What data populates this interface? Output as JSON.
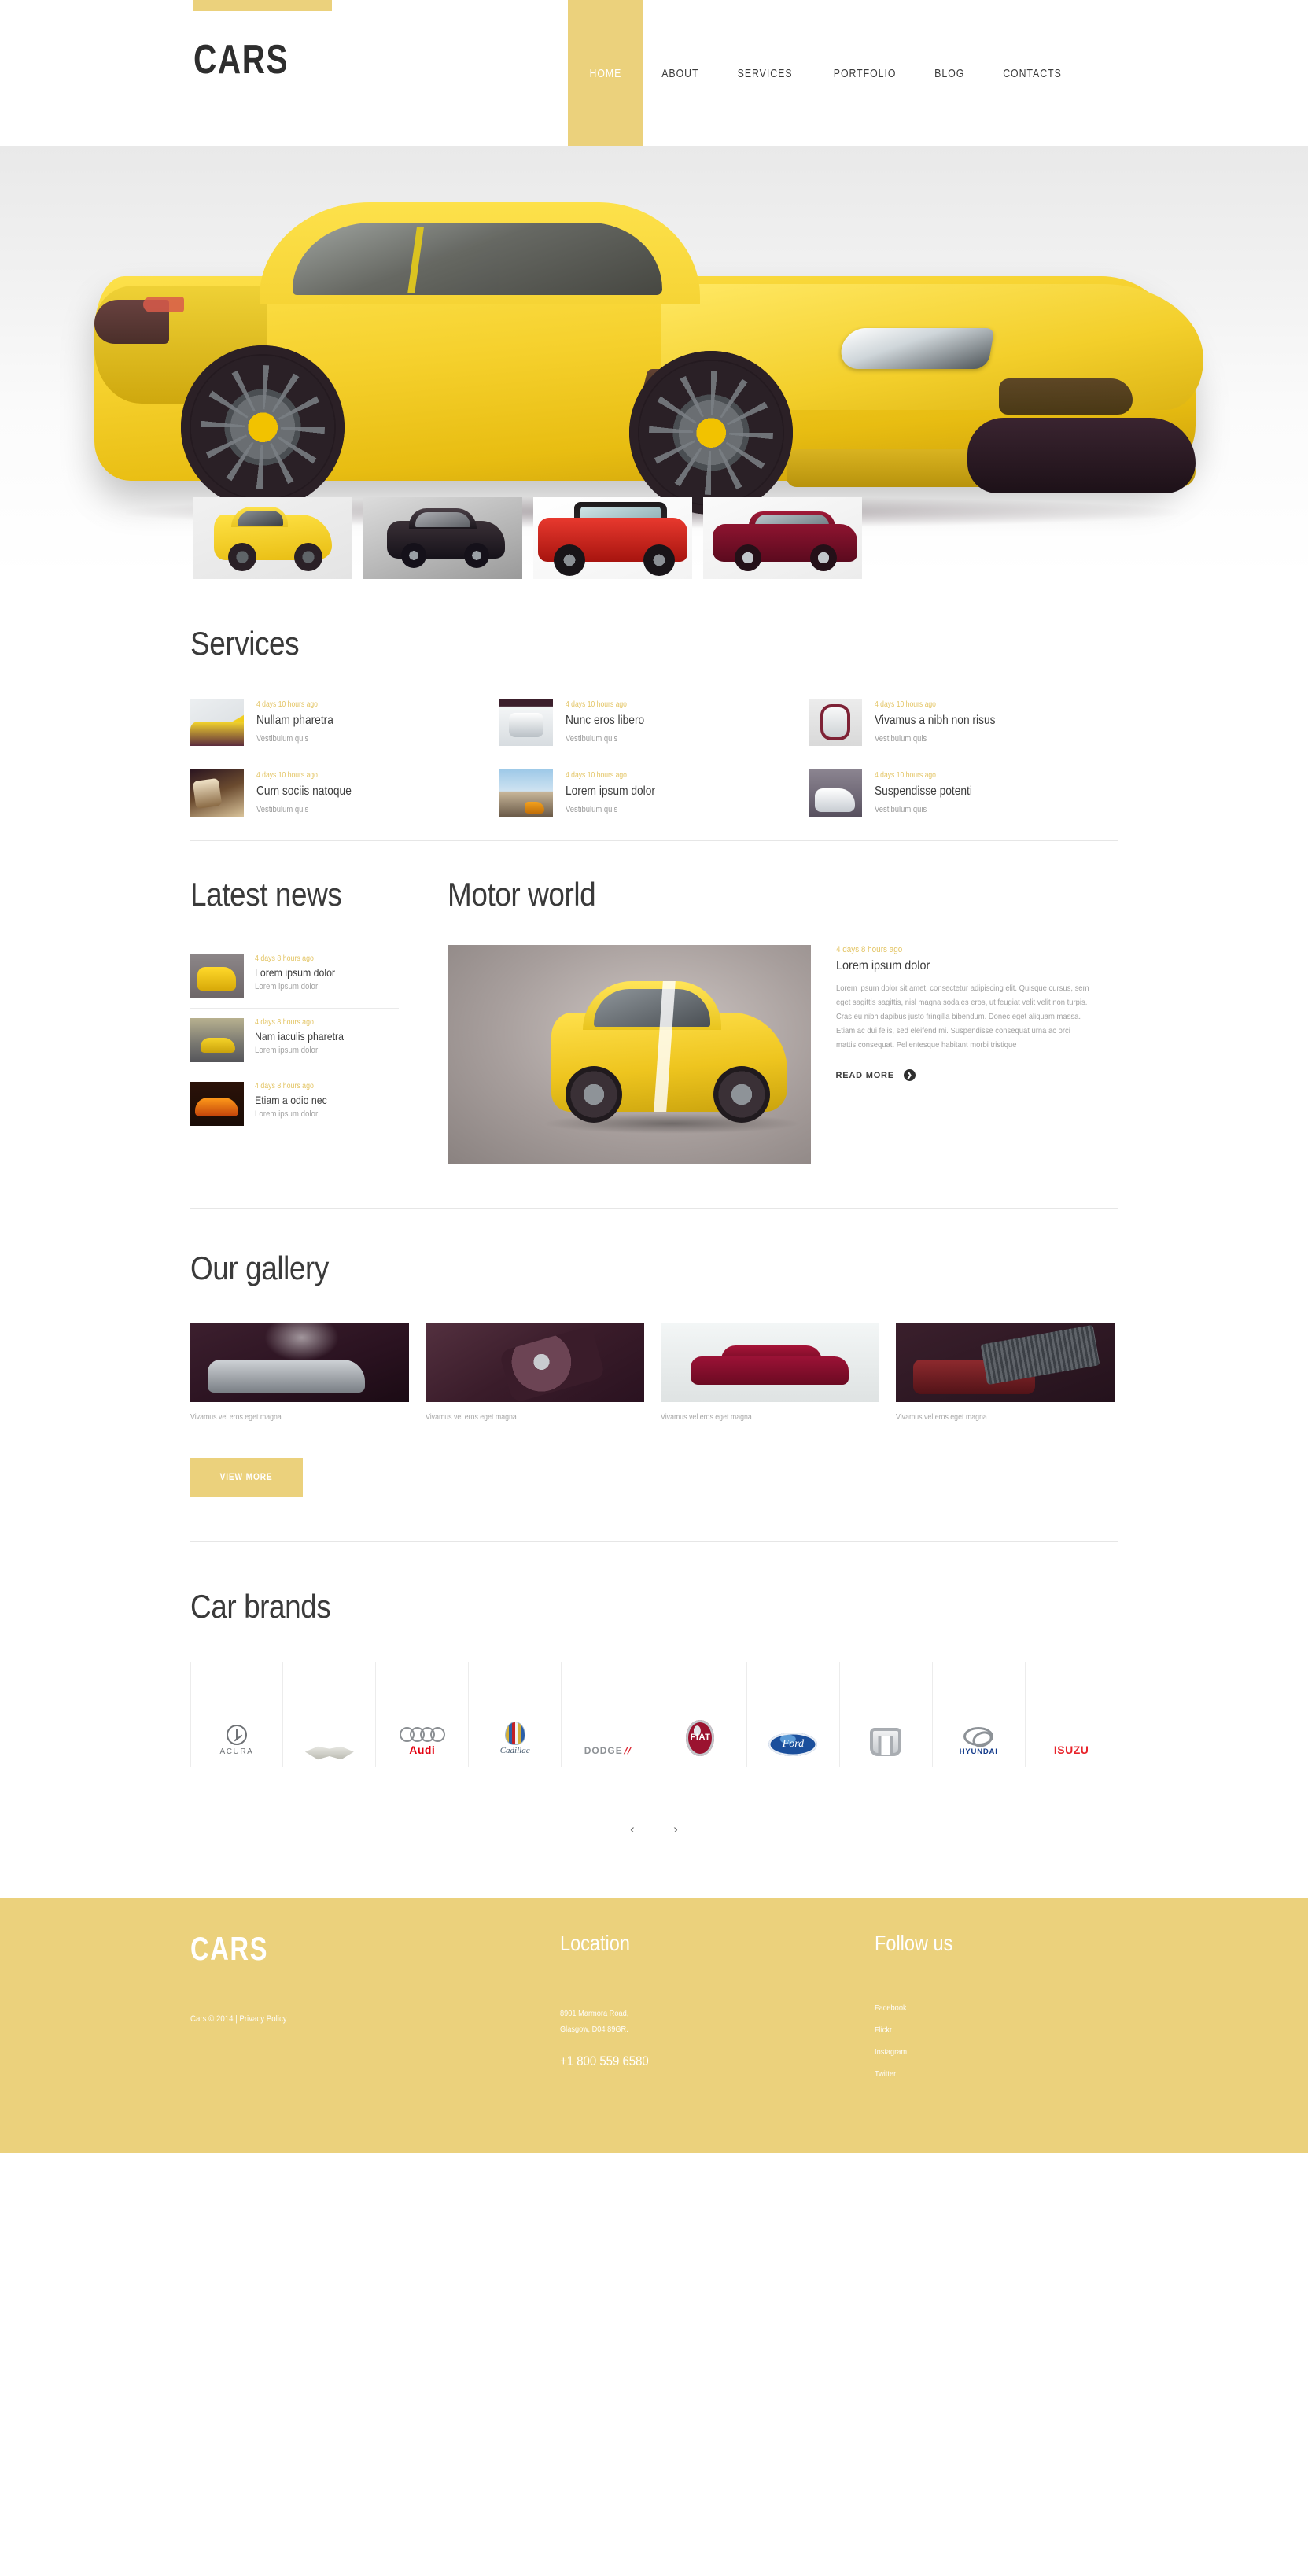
{
  "header": {
    "logo": "CARS",
    "nav": [
      {
        "label": "HOME",
        "active": true
      },
      {
        "label": "ABOUT",
        "active": false
      },
      {
        "label": "SERVICES",
        "active": false
      },
      {
        "label": "PORTFOLIO",
        "active": false
      },
      {
        "label": "BLOG",
        "active": false
      },
      {
        "label": "CONTACTS",
        "active": false
      }
    ]
  },
  "hero": {
    "thumbnails": [
      {
        "caption": "yellow-sports-car",
        "active": true
      },
      {
        "caption": "black-sedan",
        "active": false
      },
      {
        "caption": "red-suv",
        "active": false
      },
      {
        "caption": "maroon-sedan",
        "active": false
      }
    ]
  },
  "services": {
    "title": "Services",
    "items": [
      {
        "date": "4 days 10 hours ago",
        "name": "Nullam pharetra",
        "sub": "Vestibulum quis"
      },
      {
        "date": "4 days 10 hours ago",
        "name": "Nunc eros libero",
        "sub": "Vestibulum quis"
      },
      {
        "date": "4 days 10 hours ago",
        "name": "Vivamus a nibh non risus",
        "sub": "Vestibulum quis"
      },
      {
        "date": "4 days 10 hours ago",
        "name": "Cum sociis natoque",
        "sub": "Vestibulum quis"
      },
      {
        "date": "4 days 10 hours ago",
        "name": "Lorem ipsum dolor",
        "sub": "Vestibulum quis"
      },
      {
        "date": "4 days 10 hours ago",
        "name": "Suspendisse potenti",
        "sub": "Vestibulum quis"
      }
    ]
  },
  "latest_news": {
    "title": "Latest news",
    "items": [
      {
        "date": "4 days 8 hours ago",
        "title": "Lorem ipsum dolor",
        "sub": "Lorem ipsum dolor"
      },
      {
        "date": "4 days 8 hours ago",
        "title": "Nam iaculis pharetra",
        "sub": "Lorem ipsum dolor"
      },
      {
        "date": "4 days 8 hours ago",
        "title": "Etiam a odio nec",
        "sub": "Lorem ipsum dolor"
      }
    ]
  },
  "motor_world": {
    "title": "Motor world",
    "date": "4 days 8 hours ago",
    "post_title": "Lorem ipsum dolor",
    "body": "Lorem ipsum dolor sit amet, consectetur adipiscing elit. Quisque cursus, sem eget sagittis sagittis, nisl magna sodales eros, ut feugiat velit velit non turpis. Cras eu nibh dapibus justo fringilla bibendum. Donec eget aliquam massa. Etiam ac dui felis, sed eleifend mi. Suspendisse consequat urna ac orci mattis consequat. Pellentesque habitant morbi tristique",
    "read_more": "READ MORE",
    "read_more_arrow": "❯"
  },
  "gallery": {
    "title": "Our gallery",
    "items": [
      {
        "caption": "Vivamus vel eros eget magna"
      },
      {
        "caption": "Vivamus vel eros eget magna"
      },
      {
        "caption": "Vivamus vel eros eget magna"
      },
      {
        "caption": "Vivamus vel eros eget magna"
      }
    ],
    "view_more": "VIEW MORE"
  },
  "brands": {
    "title": "Car brands",
    "items": [
      {
        "name": "ACURA"
      },
      {
        "name": "ASTON MARTIN"
      },
      {
        "name": "Audi"
      },
      {
        "name": "Cadillac"
      },
      {
        "name": "DODGE"
      },
      {
        "name": "FIAT"
      },
      {
        "name": "Ford"
      },
      {
        "name": "HONDA"
      },
      {
        "name": "HYUNDAI"
      },
      {
        "name": "ISUZU"
      }
    ],
    "prev": "‹",
    "next": "›"
  },
  "footer": {
    "logo": "CARS",
    "copyright": "Cars © 2014 | Privacy Policy",
    "location_title": "Location",
    "address_line1": "8901 Marmora Road,",
    "address_line2": "Glasgow, D04 89GR.",
    "phone": "+1 800 559 6580",
    "follow_title": "Follow us",
    "social": [
      "Facebook",
      "Flickr",
      "Instagram",
      "Twitter"
    ]
  },
  "colors": {
    "accent": "#ebd17c",
    "date_text": "#e3c463",
    "heading": "#3a3a3a",
    "muted": "#a0a0a0"
  }
}
